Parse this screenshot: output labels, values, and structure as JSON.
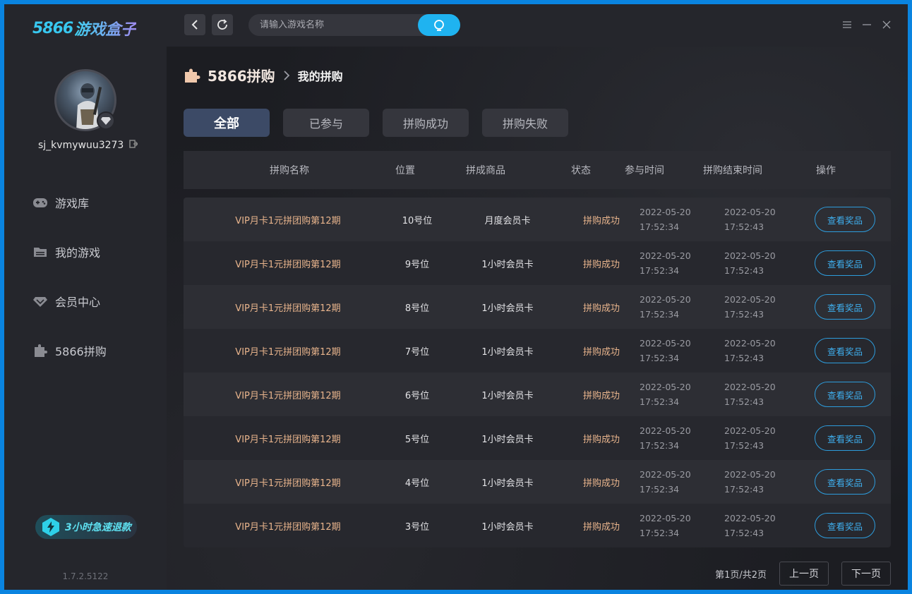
{
  "app": {
    "logo_number": "5866",
    "logo_text": "游戏盒子",
    "version": "1.7.2.5122"
  },
  "user": {
    "name": "sj_kvmywuu3273"
  },
  "sidebar": {
    "items": [
      {
        "label": "游戏库",
        "icon": "gamepad-icon"
      },
      {
        "label": "我的游戏",
        "icon": "folder-icon"
      },
      {
        "label": "会员中心",
        "icon": "diamond-icon"
      },
      {
        "label": "5866拼购",
        "icon": "puzzle-icon"
      }
    ],
    "speed_badge": "3小时急速退款"
  },
  "search": {
    "placeholder": "请输入游戏名称"
  },
  "breadcrumb": {
    "root": "5866拼购",
    "current": "我的拼购"
  },
  "tabs": [
    {
      "label": "全部",
      "active": true
    },
    {
      "label": "已参与",
      "active": false
    },
    {
      "label": "拼购成功",
      "active": false
    },
    {
      "label": "拼购失败",
      "active": false
    }
  ],
  "table": {
    "headers": {
      "name": "拼购名称",
      "position": "位置",
      "product": "拼成商品",
      "status": "状态",
      "join_time": "参与时间",
      "end_time": "拼购结束时间",
      "action": "操作"
    },
    "rows": [
      {
        "name": "VIP月卡1元拼团购第12期",
        "position": "10号位",
        "product": "月度会员卡",
        "status": "拼购成功",
        "join_date": "2022-05-20",
        "join_clock": "17:52:34",
        "end_date": "2022-05-20",
        "end_clock": "17:52:43",
        "action": "查看奖品"
      },
      {
        "name": "VIP月卡1元拼团购第12期",
        "position": "9号位",
        "product": "1小时会员卡",
        "status": "拼购成功",
        "join_date": "2022-05-20",
        "join_clock": "17:52:34",
        "end_date": "2022-05-20",
        "end_clock": "17:52:43",
        "action": "查看奖品"
      },
      {
        "name": "VIP月卡1元拼团购第12期",
        "position": "8号位",
        "product": "1小时会员卡",
        "status": "拼购成功",
        "join_date": "2022-05-20",
        "join_clock": "17:52:34",
        "end_date": "2022-05-20",
        "end_clock": "17:52:43",
        "action": "查看奖品"
      },
      {
        "name": "VIP月卡1元拼团购第12期",
        "position": "7号位",
        "product": "1小时会员卡",
        "status": "拼购成功",
        "join_date": "2022-05-20",
        "join_clock": "17:52:34",
        "end_date": "2022-05-20",
        "end_clock": "17:52:43",
        "action": "查看奖品"
      },
      {
        "name": "VIP月卡1元拼团购第12期",
        "position": "6号位",
        "product": "1小时会员卡",
        "status": "拼购成功",
        "join_date": "2022-05-20",
        "join_clock": "17:52:34",
        "end_date": "2022-05-20",
        "end_clock": "17:52:43",
        "action": "查看奖品"
      },
      {
        "name": "VIP月卡1元拼团购第12期",
        "position": "5号位",
        "product": "1小时会员卡",
        "status": "拼购成功",
        "join_date": "2022-05-20",
        "join_clock": "17:52:34",
        "end_date": "2022-05-20",
        "end_clock": "17:52:43",
        "action": "查看奖品"
      },
      {
        "name": "VIP月卡1元拼团购第12期",
        "position": "4号位",
        "product": "1小时会员卡",
        "status": "拼购成功",
        "join_date": "2022-05-20",
        "join_clock": "17:52:34",
        "end_date": "2022-05-20",
        "end_clock": "17:52:43",
        "action": "查看奖品"
      },
      {
        "name": "VIP月卡1元拼团购第12期",
        "position": "3号位",
        "product": "1小时会员卡",
        "status": "拼购成功",
        "join_date": "2022-05-20",
        "join_clock": "17:52:34",
        "end_date": "2022-05-20",
        "end_clock": "17:52:43",
        "action": "查看奖品"
      }
    ]
  },
  "pager": {
    "info": "第1页/共2页",
    "prev": "上一页",
    "next": "下一页"
  },
  "colors": {
    "accent": "#1fb3f0",
    "status": "#e8b48c",
    "frame": "#0a84e0"
  }
}
